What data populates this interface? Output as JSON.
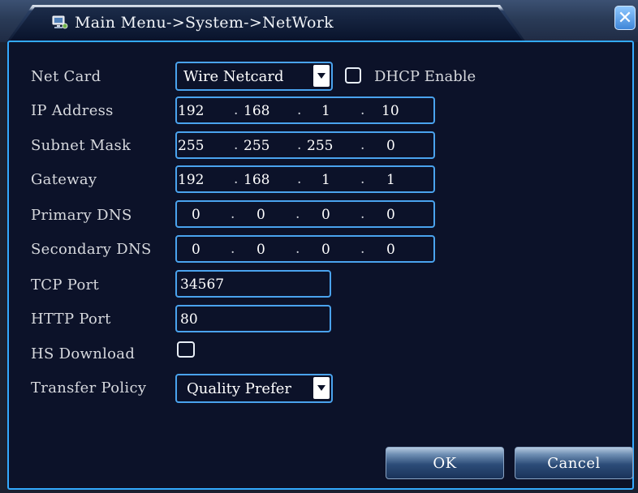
{
  "window": {
    "title": "Main Menu->System->NetWork",
    "close_glyph": "✕"
  },
  "net_card": {
    "label": "Net Card",
    "value": "Wire Netcard"
  },
  "dhcp": {
    "label": "DHCP Enable",
    "checked": false
  },
  "ip_address": {
    "label": "IP Address",
    "octets": [
      "192",
      "168",
      "1",
      "10"
    ]
  },
  "subnet_mask": {
    "label": "Subnet Mask",
    "octets": [
      "255",
      "255",
      "255",
      "0"
    ]
  },
  "gateway": {
    "label": "Gateway",
    "octets": [
      "192",
      "168",
      "1",
      "1"
    ]
  },
  "primary_dns": {
    "label": "Primary DNS",
    "octets": [
      "0",
      "0",
      "0",
      "0"
    ]
  },
  "secondary_dns": {
    "label": "Secondary DNS",
    "octets": [
      "0",
      "0",
      "0",
      "0"
    ]
  },
  "tcp_port": {
    "label": "TCP Port",
    "value": "34567"
  },
  "http_port": {
    "label": "HTTP Port",
    "value": "80"
  },
  "hs_download": {
    "label": "HS Download",
    "checked": false
  },
  "transfer_policy": {
    "label": "Transfer Policy",
    "value": "Quality Prefer"
  },
  "buttons": {
    "ok": "OK",
    "cancel": "Cancel"
  },
  "colors": {
    "accent": "#4aa3ee",
    "panel_bg": "#0c1229",
    "close_button": "#3f86d8"
  },
  "icons": {
    "title": "network-computer-icon",
    "close": "close-icon",
    "dropdown": "chevron-down-icon"
  }
}
